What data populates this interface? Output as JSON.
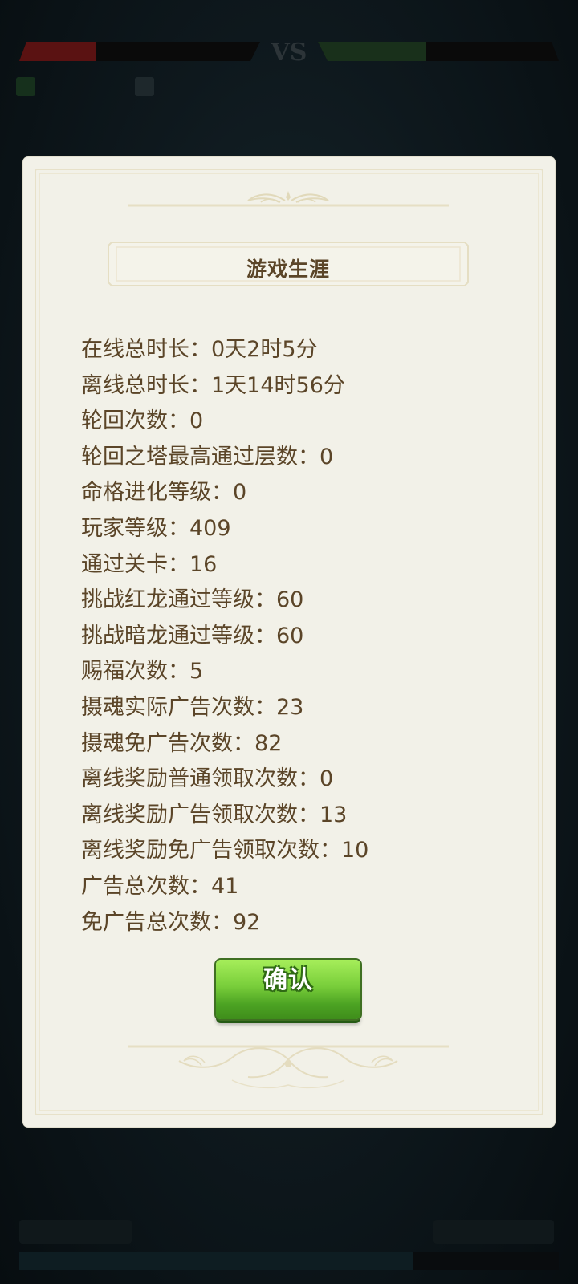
{
  "colors": {
    "panel_bg": "#f2f1e8",
    "text": "#5b4528",
    "button_green": "#78cd3a"
  },
  "dialog": {
    "title": "游戏生涯",
    "stats": [
      "在线总时长：0天2时5分",
      "离线总时长：1天14时56分",
      "轮回次数：0",
      "轮回之塔最高通过层数：0",
      "命格进化等级：0",
      "玩家等级：409",
      "通过关卡：16",
      "挑战红龙通过等级：60",
      "挑战暗龙通过等级：60",
      "赐福次数：5",
      "摄魂实际广告次数：23",
      "摄魂免广告次数：82",
      "离线奖励普通领取次数：0",
      "离线奖励广告领取次数：13",
      "离线奖励免广告领取次数：10",
      "广告总次数：41",
      "免广告总次数：92"
    ],
    "confirm_label": "确认"
  }
}
